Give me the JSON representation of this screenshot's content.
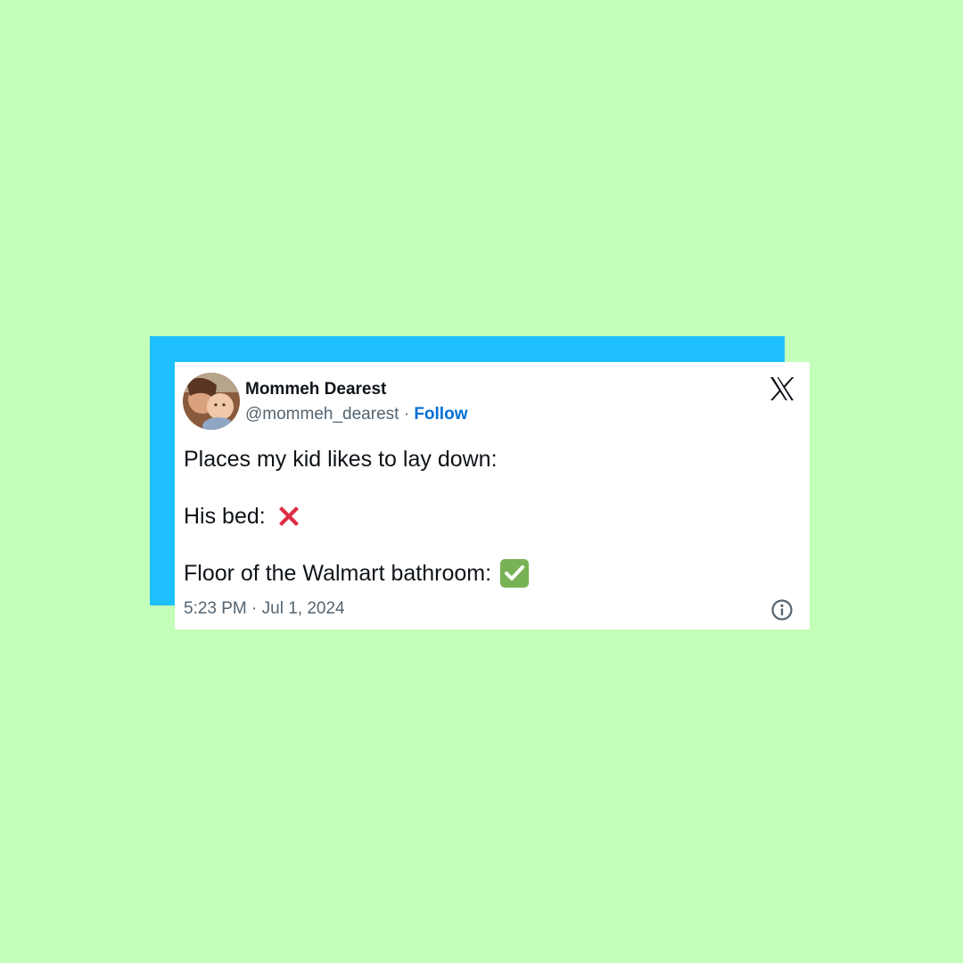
{
  "colors": {
    "background": "#c3ffb9",
    "accent_block": "#1ec0ff",
    "card": "#ffffff",
    "follow_link": "#006fd6",
    "secondary_text": "#536471",
    "cross_mark": "#dd2e44",
    "check_mark": "#77b255"
  },
  "tweet": {
    "author": {
      "display_name": "Mommeh Dearest",
      "handle": "@mommeh_dearest",
      "separator": " · ",
      "follow_label": "Follow"
    },
    "platform_icon": "x-logo-icon",
    "lines": [
      {
        "text": "Places my kid likes to lay down:",
        "emoji": null
      },
      {
        "text": "His bed:",
        "emoji": "cross-mark-icon"
      },
      {
        "text": "Floor of the Walmart bathroom:",
        "emoji": "check-mark-button-icon"
      }
    ],
    "timestamp": "5:23 PM · Jul 1, 2024",
    "info_icon": "info-icon"
  }
}
